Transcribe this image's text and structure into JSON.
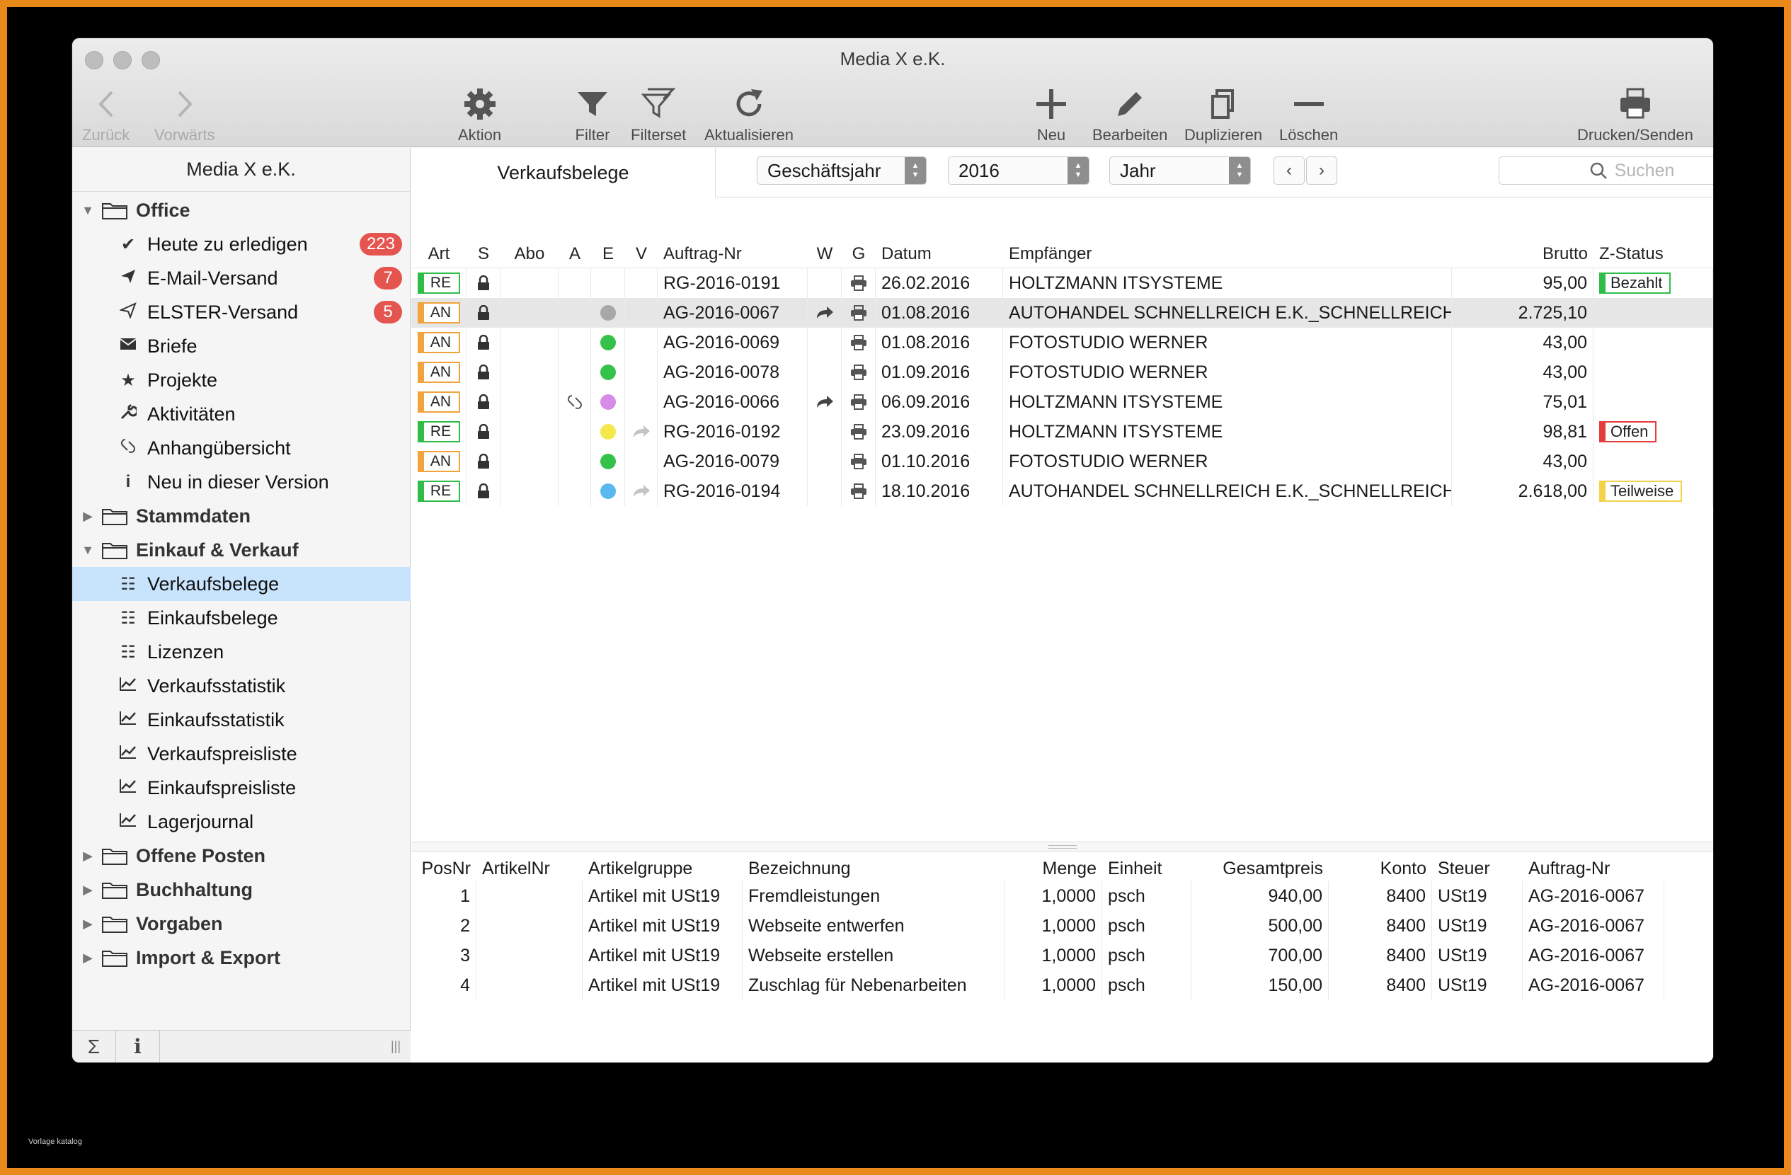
{
  "watermark": "Vorlage katalog",
  "window": {
    "title": "Media X e.K."
  },
  "toolbar": {
    "back": "Zurück",
    "forward": "Vorwärts",
    "action": "Aktion",
    "filter": "Filter",
    "filterset": "Filterset",
    "refresh": "Aktualisieren",
    "new": "Neu",
    "edit": "Bearbeiten",
    "duplicate": "Duplizieren",
    "delete": "Löschen",
    "print": "Drucken/Senden"
  },
  "sidebar": {
    "header": "Media X e.K.",
    "groups": {
      "office": "Office",
      "stammdaten": "Stammdaten",
      "einkauf_verkauf": "Einkauf & Verkauf",
      "offene_posten": "Offene Posten",
      "buchhaltung": "Buchhaltung",
      "vorgaben": "Vorgaben",
      "import_export": "Import & Export"
    },
    "office_items": [
      {
        "label": "Heute zu erledigen",
        "icon": "checkmark-icon",
        "badge": "223"
      },
      {
        "label": "E-Mail-Versand",
        "icon": "paper-plane-icon",
        "badge": "7"
      },
      {
        "label": "ELSTER-Versand",
        "icon": "paper-plane-outline-icon",
        "badge": "5"
      },
      {
        "label": "Briefe",
        "icon": "envelope-icon"
      },
      {
        "label": "Projekte",
        "icon": "star-icon"
      },
      {
        "label": "Aktivitäten",
        "icon": "wrench-icon"
      },
      {
        "label": "Anhangübersicht",
        "icon": "paperclip-icon"
      },
      {
        "label": "Neu in dieser Version",
        "icon": "info-icon"
      }
    ],
    "ev_items": [
      {
        "label": "Verkaufsbelege",
        "icon": "list-icon",
        "selected": true
      },
      {
        "label": "Einkaufsbelege",
        "icon": "list-icon"
      },
      {
        "label": "Lizenzen",
        "icon": "list-icon"
      },
      {
        "label": "Verkaufsstatistik",
        "icon": "chart-icon"
      },
      {
        "label": "Einkaufsstatistik",
        "icon": "chart-icon"
      },
      {
        "label": "Verkaufspreisliste",
        "icon": "chart-icon"
      },
      {
        "label": "Einkaufspreisliste",
        "icon": "chart-icon"
      },
      {
        "label": "Lagerjournal",
        "icon": "chart-icon"
      }
    ],
    "footer": {
      "sum": "Σ",
      "info": "i",
      "grip": "|||"
    }
  },
  "main": {
    "tab": "Verkaufsbelege",
    "period_select": "Geschäftsjahr",
    "year_select": "2016",
    "range_select": "Jahr",
    "prev": "‹",
    "next": "›",
    "search_placeholder": "Suchen"
  },
  "upper_table": {
    "headers": {
      "art": "Art",
      "s": "S",
      "abo": "Abo",
      "a": "A",
      "e": "E",
      "v": "V",
      "auftrag": "Auftrag-Nr",
      "w": "W",
      "g": "G",
      "datum": "Datum",
      "empfaenger": "Empfänger",
      "brutto": "Brutto",
      "zstatus": "Z-Status"
    },
    "rows": [
      {
        "art": "RE",
        "attach": false,
        "e": "",
        "v": false,
        "auftrag": "RG-2016-0191",
        "w": false,
        "datum": "26.02.2016",
        "empfaenger": "HOLTZMANN ITSYSTEME",
        "brutto": "95,00",
        "zstatus": "Bezahlt",
        "zcolor": "green",
        "highlight": false
      },
      {
        "art": "AN",
        "attach": false,
        "e": "gray",
        "v": false,
        "auftrag": "AG-2016-0067",
        "w": true,
        "datum": "01.08.2016",
        "empfaenger": "AUTOHANDEL SCHNELLREICH E.K._SCHNELLREICH...",
        "brutto": "2.725,10",
        "zstatus": "",
        "zcolor": "",
        "highlight": true
      },
      {
        "art": "AN",
        "attach": false,
        "e": "green",
        "v": false,
        "auftrag": "AG-2016-0069",
        "w": false,
        "datum": "01.08.2016",
        "empfaenger": "FOTOSTUDIO WERNER",
        "brutto": "43,00",
        "zstatus": "",
        "zcolor": "",
        "highlight": false
      },
      {
        "art": "AN",
        "attach": false,
        "e": "green",
        "v": false,
        "auftrag": "AG-2016-0078",
        "w": false,
        "datum": "01.09.2016",
        "empfaenger": "FOTOSTUDIO WERNER",
        "brutto": "43,00",
        "zstatus": "",
        "zcolor": "",
        "highlight": false
      },
      {
        "art": "AN",
        "attach": true,
        "e": "violet",
        "v": false,
        "auftrag": "AG-2016-0066",
        "w": true,
        "datum": "06.09.2016",
        "empfaenger": "HOLTZMANN ITSYSTEME",
        "brutto": "75,01",
        "zstatus": "",
        "zcolor": "",
        "highlight": false
      },
      {
        "art": "RE",
        "attach": false,
        "e": "yellow",
        "v": true,
        "auftrag": "RG-2016-0192",
        "w": false,
        "datum": "23.09.2016",
        "empfaenger": "HOLTZMANN ITSYSTEME",
        "brutto": "98,81",
        "zstatus": "Offen",
        "zcolor": "red",
        "highlight": false
      },
      {
        "art": "AN",
        "attach": false,
        "e": "green",
        "v": false,
        "auftrag": "AG-2016-0079",
        "w": false,
        "datum": "01.10.2016",
        "empfaenger": "FOTOSTUDIO WERNER",
        "brutto": "43,00",
        "zstatus": "",
        "zcolor": "",
        "highlight": false
      },
      {
        "art": "RE",
        "attach": false,
        "e": "blue",
        "v": true,
        "auftrag": "RG-2016-0194",
        "w": false,
        "datum": "18.10.2016",
        "empfaenger": "AUTOHANDEL SCHNELLREICH E.K._SCHNELLREICH...",
        "brutto": "2.618,00",
        "zstatus": "Teilweise",
        "zcolor": "yellow",
        "highlight": false
      }
    ]
  },
  "dot_colors": {
    "gray": "#a8a8a8",
    "green": "#35c24a",
    "violet": "#d98be8",
    "yellow": "#f5e84a",
    "blue": "#5ab8f0"
  },
  "lower_table": {
    "headers": {
      "posnr": "PosNr",
      "artikelnr": "ArtikelNr",
      "artikelgruppe": "Artikelgruppe",
      "bezeichnung": "Bezeichnung",
      "menge": "Menge",
      "einheit": "Einheit",
      "gesamtpreis": "Gesamtpreis",
      "konto": "Konto",
      "steuer": "Steuer",
      "auftrag": "Auftrag-Nr"
    },
    "rows": [
      {
        "posnr": "1",
        "artikelnr": "",
        "artikelgruppe": "Artikel mit USt19",
        "bezeichnung": "Fremdleistungen",
        "menge": "1,0000",
        "einheit": "psch",
        "gesamtpreis": "940,00",
        "konto": "8400",
        "steuer": "USt19",
        "auftrag": "AG-2016-0067"
      },
      {
        "posnr": "2",
        "artikelnr": "",
        "artikelgruppe": "Artikel mit USt19",
        "bezeichnung": "Webseite entwerfen",
        "menge": "1,0000",
        "einheit": "psch",
        "gesamtpreis": "500,00",
        "konto": "8400",
        "steuer": "USt19",
        "auftrag": "AG-2016-0067"
      },
      {
        "posnr": "3",
        "artikelnr": "",
        "artikelgruppe": "Artikel mit USt19",
        "bezeichnung": "Webseite erstellen",
        "menge": "1,0000",
        "einheit": "psch",
        "gesamtpreis": "700,00",
        "konto": "8400",
        "steuer": "USt19",
        "auftrag": "AG-2016-0067"
      },
      {
        "posnr": "4",
        "artikelnr": "",
        "artikelgruppe": "Artikel mit USt19",
        "bezeichnung": "Zuschlag für Nebenarbeiten",
        "menge": "1,0000",
        "einheit": "psch",
        "gesamtpreis": "150,00",
        "konto": "8400",
        "steuer": "USt19",
        "auftrag": "AG-2016-0067"
      }
    ]
  }
}
